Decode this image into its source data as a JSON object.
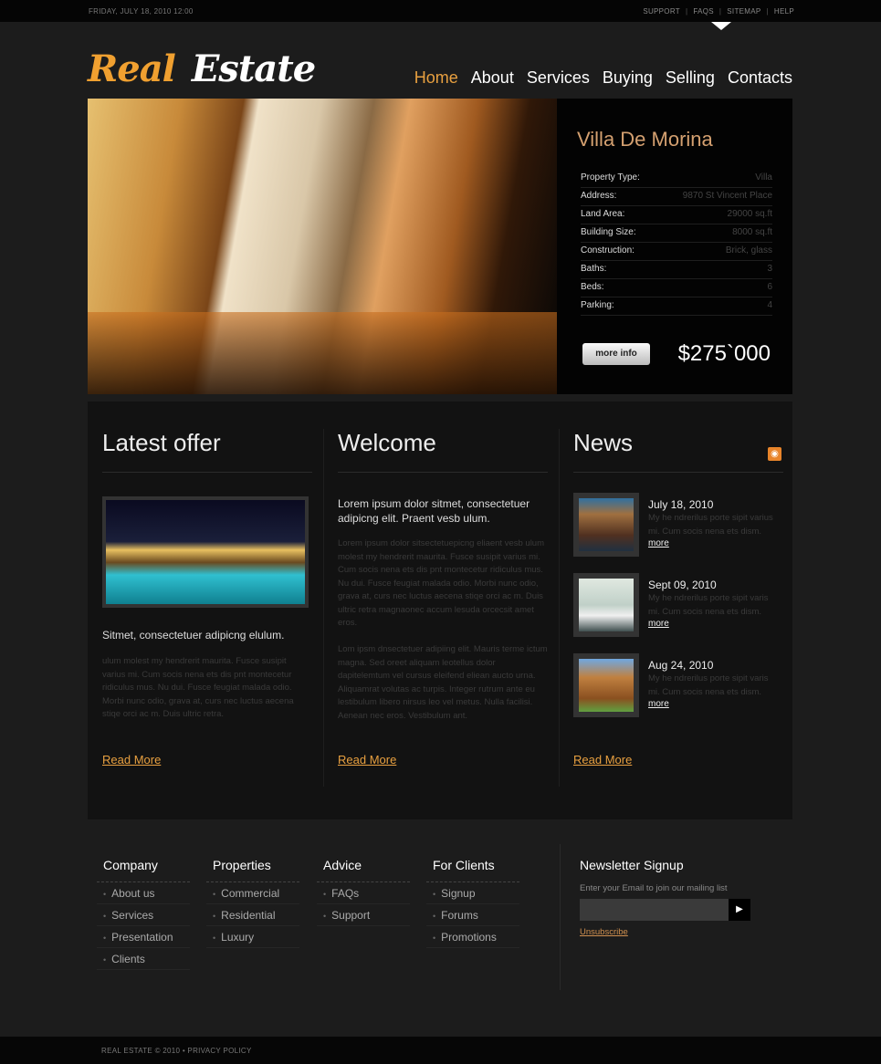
{
  "topbar": {
    "date": "FRIDAY, JULY 18, 2010 12:00",
    "links": [
      "SUPPORT",
      "FAQS",
      "SITEMAP",
      "HELP"
    ]
  },
  "logo": {
    "part1": "Real",
    "part2": "Estate"
  },
  "nav": [
    {
      "label": "Home",
      "active": true
    },
    {
      "label": "About"
    },
    {
      "label": "Services"
    },
    {
      "label": "Buying"
    },
    {
      "label": "Selling"
    },
    {
      "label": "Contacts"
    }
  ],
  "hero": {
    "title": "Villa De Morina",
    "specs": [
      [
        "Property Type:",
        "Villa"
      ],
      [
        "Address:",
        "9870 St Vincent Place"
      ],
      [
        "Land Area:",
        "29000 sq.ft"
      ],
      [
        "Building Size:",
        "8000 sq.ft"
      ],
      [
        "Construction:",
        "Brick, glass"
      ],
      [
        "Baths:",
        "3"
      ],
      [
        "Beds:",
        "6"
      ],
      [
        "Parking:",
        "4"
      ]
    ],
    "button": "more info",
    "price": "$275`000"
  },
  "latest": {
    "title": "Latest offer",
    "lead": "Sitmet, consectetuer adipicng elulum.",
    "body": "ulum molest my hendrerit maurita. Fusce susipit varius mi. Cum socis nena ets dis pnt montecetur ridiculus mus. Nu dui. Fusce feugiat malada odio. Morbi nunc odio, grava at, curs nec luctus aecena stiqe orci ac m. Duis ultric retra.",
    "read_more": "Read More"
  },
  "welcome": {
    "title": "Welcome",
    "lead": "Lorem ipsum dolor sitmet, consectetuer adipicng elit. Praent vesb ulum.",
    "body1": "Lorem ipsum dolor sitsectetuepicng eliaent vesb ulum molest my hendrerit maurita. Fusce susipit varius mi. Cum socis nena ets dis pnt montecetur ridiculus mus. Nu dui. Fusce feugiat malada odio. Morbi nunc odio, grava at, curs nec luctus aecena stiqe orci ac m. Duis ultric retra magnaonec accum lesuda orcecsit amet eros.",
    "body2": "Lom ipsm dnsectetuer adipiing elit. Mauris terme ictum magna. Sed oreet aliquam leotellus dolor dapitelemtum vel cursus eleifend eliean aucto urna. Aliquamrat volutas ac turpis. Integer rutrum ante eu lestibulum libero nirsus leo vel metus. Nulla facilisi. Aenean nec eros. Vestibulum ant.",
    "read_more": "Read More"
  },
  "news": {
    "title": "News",
    "icon": "rss-icon",
    "items": [
      {
        "date": "July 18, 2010",
        "text": "My he ndrerilus porte sipit varius mi. Cum socis nena ets dism.",
        "more": "more"
      },
      {
        "date": "Sept 09, 2010",
        "text": "My he ndrerilus porte sipit varis mi. Cum socis nena ets dism.",
        "more": "more"
      },
      {
        "date": "Aug 24, 2010",
        "text": "My he ndrerilus porte sipit varis mi. Cum socis nena ets dism.",
        "more": "more"
      }
    ],
    "read_more": "Read More"
  },
  "footer": {
    "columns": [
      {
        "title": "Company",
        "items": [
          "About us",
          "Services",
          "Presentation",
          "Clients"
        ]
      },
      {
        "title": "Properties",
        "items": [
          "Commercial",
          "Residential",
          "Luxury"
        ]
      },
      {
        "title": "Advice",
        "items": [
          "FAQs",
          "Support"
        ]
      },
      {
        "title": "For Clients",
        "items": [
          "Signup",
          "Forums",
          "Promotions"
        ]
      }
    ],
    "newsletter": {
      "title": "Newsletter Signup",
      "hint": "Enter your Email to join our mailing list",
      "email_value": "",
      "unsubscribe": "Unsubscribe"
    },
    "copyright": "REAL ESTATE © 2010 • PRIVACY POLICY"
  },
  "colors": {
    "accent": "#e8a040",
    "background": "#1c1c1c"
  }
}
